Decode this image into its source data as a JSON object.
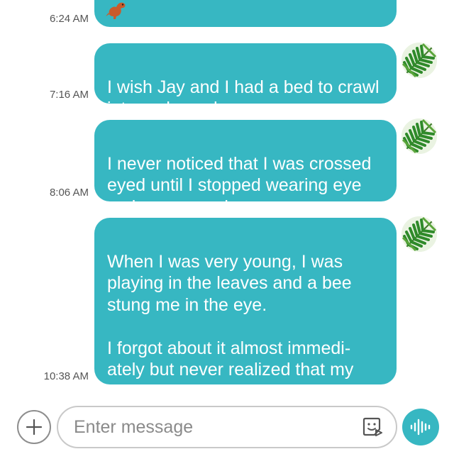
{
  "messages": [
    {
      "text": "",
      "time": "6:24 AM"
    },
    {
      "text": "I wish Jay and I had a bed to crawl\ninto and weed.",
      "time": "7:16 AM"
    },
    {
      "text": "I never noticed that I was crossed\neyed until I stopped wearing eye\nmakeup everyday.",
      "time": "8:06 AM"
    },
    {
      "text": "When I was very young, I was\nplaying in the leaves and a bee\nstung me in the eye.\n\nI forgot about it almost immedi-\nately but never realized that my\neyes are kind of fucked up.",
      "time": "10:38 AM"
    }
  ],
  "composer": {
    "placeholder": "Enter message"
  },
  "icons": {
    "emoji": "dinosaur-emoji",
    "avatar": "fern-leaf-avatar",
    "add": "plus-icon",
    "sticker": "sticker-icon",
    "voice": "voice-wave-icon"
  },
  "colors": {
    "bubble": "#37b7c2",
    "accent": "#37b7c2",
    "time_text": "#555555",
    "placeholder": "#8a8a8a"
  }
}
